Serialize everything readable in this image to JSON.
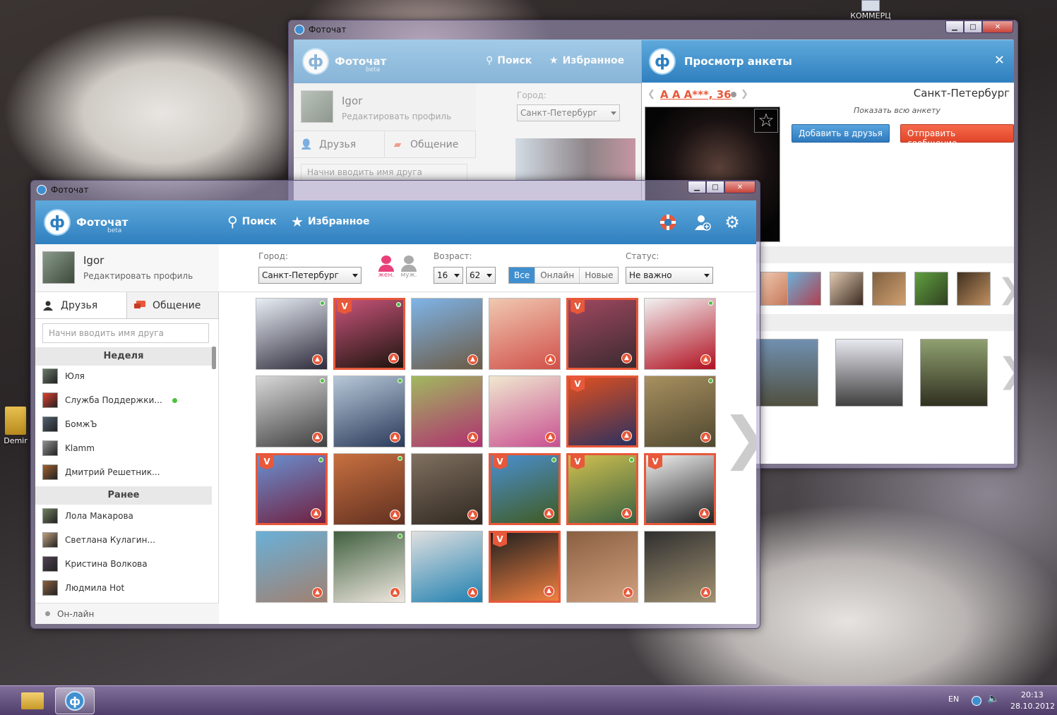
{
  "desktop": {
    "icon_left_label": "Demir",
    "icon_top_label": "КОММЕРЦ"
  },
  "app": {
    "window_title": "Фоточат",
    "brand": "Фоточат",
    "brand_sub": "beta",
    "logo_letter": "ф",
    "nav_search": "Поиск",
    "nav_favorites": "Избранное"
  },
  "profile": {
    "name": "Igor",
    "edit_label": "Редактировать профиль"
  },
  "tabs": {
    "friends": "Друзья",
    "chat": "Общение"
  },
  "search": {
    "placeholder": "Начни вводить имя друга"
  },
  "sections": {
    "week": "Неделя",
    "earlier": "Ранее"
  },
  "friends_week": [
    {
      "name": "Юля",
      "online": false
    },
    {
      "name": "Служба Поддержки...",
      "online": true
    },
    {
      "name": "БомжЪ",
      "online": false
    },
    {
      "name": "Klamm",
      "online": false
    },
    {
      "name": "Дмитрий Решетник...",
      "online": false
    }
  ],
  "friends_earlier": [
    {
      "name": "Лола Макарова"
    },
    {
      "name": "Светлана Кулагин..."
    },
    {
      "name": "Кристина Волкова"
    },
    {
      "name": "Людмила Hot"
    }
  ],
  "footer": {
    "online_label": "Он-лайн"
  },
  "filters": {
    "city_label": "Город:",
    "city_value": "Санкт-Петербург",
    "gender_female": "жен.",
    "gender_male": "муж.",
    "age_label": "Возраст:",
    "age_from": "16",
    "age_to": "62",
    "seg_all": "Все",
    "seg_online": "Онлайн",
    "seg_new": "Новые",
    "status_label": "Статус:",
    "status_value": "Не важно"
  },
  "photos": [
    {
      "vip": false,
      "online": true,
      "c1": "#e8eef5",
      "c2": "#2d2a3a"
    },
    {
      "vip": true,
      "online": true,
      "c1": "#c8547a",
      "c2": "#1e140e"
    },
    {
      "vip": false,
      "online": false,
      "c1": "#7fb4e8",
      "c2": "#6b5a44"
    },
    {
      "vip": false,
      "online": false,
      "c1": "#f0c8b0",
      "c2": "#d0504a"
    },
    {
      "vip": true,
      "online": false,
      "c1": "#a04860",
      "c2": "#3a2a30"
    },
    {
      "vip": false,
      "online": true,
      "c1": "#f2f2f2",
      "c2": "#b01020"
    },
    {
      "vip": false,
      "online": true,
      "c1": "#d8d8d8",
      "c2": "#404040"
    },
    {
      "vip": false,
      "online": true,
      "c1": "#b8c8d8",
      "c2": "#2a3a5a"
    },
    {
      "vip": false,
      "online": false,
      "c1": "#a0b860",
      "c2": "#b03070"
    },
    {
      "vip": false,
      "online": false,
      "c1": "#f0e8d0",
      "c2": "#c85090"
    },
    {
      "vip": true,
      "online": false,
      "c1": "#e05020",
      "c2": "#2a3060"
    },
    {
      "vip": false,
      "online": true,
      "c1": "#a89060",
      "c2": "#504830"
    },
    {
      "vip": true,
      "online": true,
      "c1": "#6a90d0",
      "c2": "#702040"
    },
    {
      "vip": false,
      "online": true,
      "c1": "#c87040",
      "c2": "#603020"
    },
    {
      "vip": false,
      "online": false,
      "c1": "#807060",
      "c2": "#302820"
    },
    {
      "vip": true,
      "online": true,
      "c1": "#4a90d0",
      "c2": "#405a20"
    },
    {
      "vip": true,
      "online": true,
      "c1": "#d0c050",
      "c2": "#3a6040"
    },
    {
      "vip": true,
      "online": false,
      "c1": "#f0f0f0",
      "c2": "#202020"
    },
    {
      "vip": false,
      "online": false,
      "c1": "#6ab0d8",
      "c2": "#a08070"
    },
    {
      "vip": false,
      "online": true,
      "c1": "#406040",
      "c2": "#f0e8e0"
    },
    {
      "vip": false,
      "online": false,
      "c1": "#e0e0e0",
      "c2": "#2080b0"
    },
    {
      "vip": true,
      "online": false,
      "c1": "#202020",
      "c2": "#f08040"
    },
    {
      "vip": false,
      "online": false,
      "c1": "#8a6040",
      "c2": "#d0a080"
    },
    {
      "vip": false,
      "online": false,
      "c1": "#303030",
      "c2": "#a09070"
    }
  ],
  "profile_view": {
    "title": "Просмотр анкеты",
    "name": "А А А***, 36",
    "city": "Санкт-Петербург",
    "show_all": "Показать всю анкету",
    "add_friend": "Добавить в друзья",
    "send_message": "Отправить сообщение"
  },
  "taskbar": {
    "lang": "EN",
    "time": "20:13",
    "date": "28.10.2012"
  }
}
